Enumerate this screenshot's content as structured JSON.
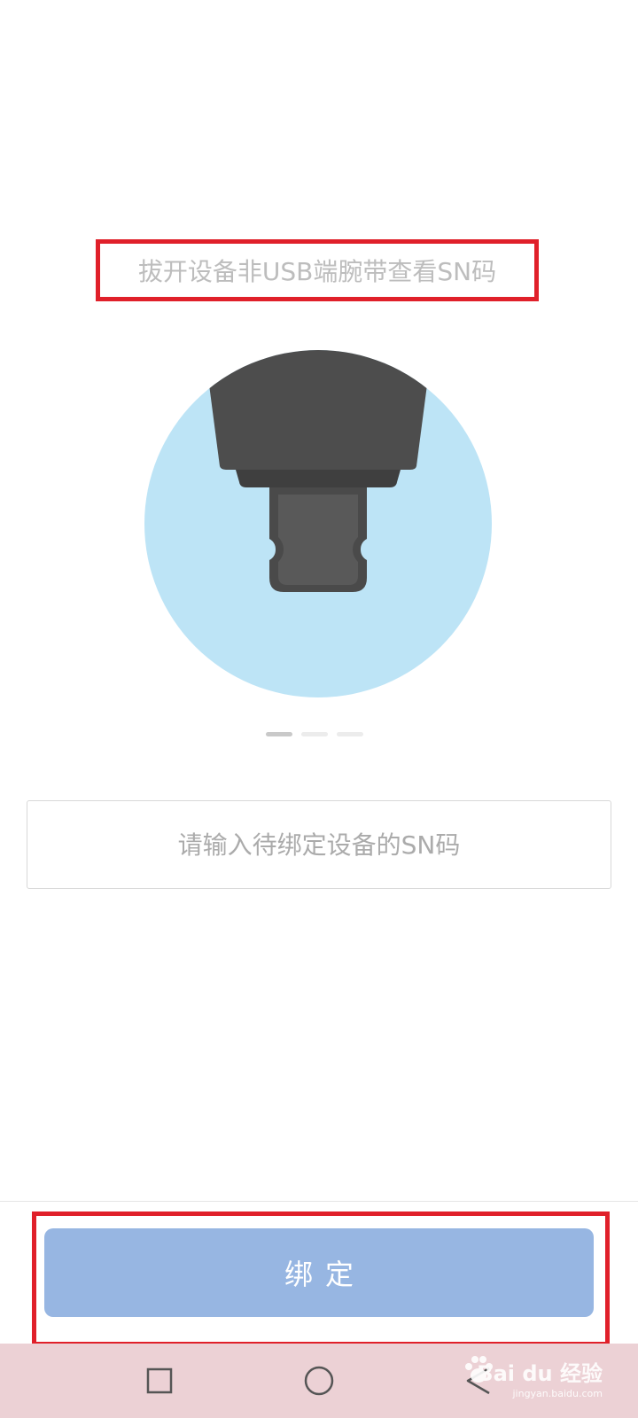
{
  "instruction": {
    "text": "拔开设备非USB端腕带查看SN码"
  },
  "illustration": {
    "circle_color": "#bde4f6",
    "device_color": "#4d4d4d"
  },
  "pager": {
    "total": 3,
    "active_index": 0
  },
  "sn_input": {
    "placeholder": "请输入待绑定设备的SN码",
    "value": ""
  },
  "bind_button": {
    "label": "绑定",
    "color": "#97b6e2"
  },
  "nav_bar": {
    "buttons": [
      {
        "icon": "square-icon"
      },
      {
        "icon": "circle-icon"
      },
      {
        "icon": "back-triangle-icon"
      }
    ],
    "background": "#ecd1d5"
  },
  "watermark": {
    "brand": "Bai du 经验",
    "url": "jingyan.baidu.com"
  }
}
